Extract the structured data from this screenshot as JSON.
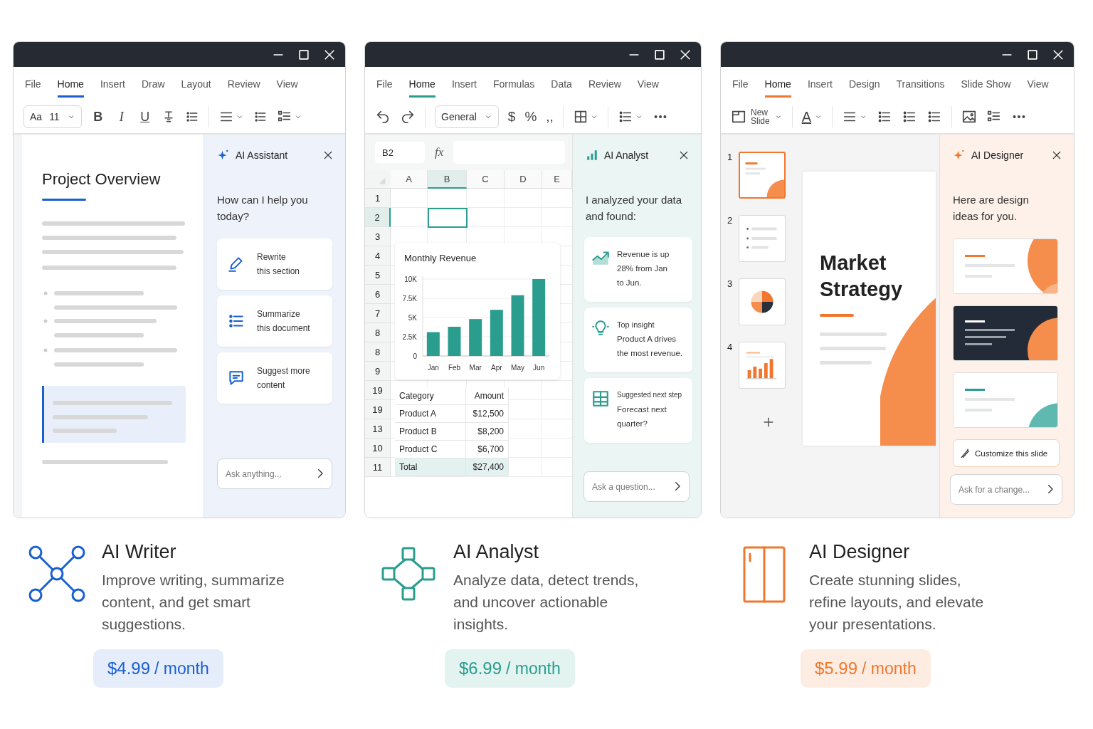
{
  "products": [
    {
      "kind": "writer",
      "menu": [
        {
          "label": "File",
          "selected": false
        },
        {
          "label": "Home",
          "selected": true
        },
        {
          "label": "Insert",
          "selected": false
        },
        {
          "label": "Draw",
          "selected": false
        },
        {
          "label": "Layout",
          "selected": false
        },
        {
          "label": "Review",
          "selected": false
        },
        {
          "label": "View",
          "selected": false
        }
      ],
      "toolbar": {
        "font": "Aa",
        "size": "11",
        "styles": [
          {
            "kind": "bold",
            "label": "B"
          },
          {
            "kind": "italic",
            "label": "I"
          },
          {
            "kind": "underline",
            "label": "U"
          }
        ]
      },
      "document": {
        "title": "Project Overview"
      },
      "panel": {
        "title": "AI Assistant",
        "message": "How can I help you\ntoday?",
        "actions": [
          {
            "kind": "rewrite",
            "label": "Rewrite\nthis section"
          },
          {
            "kind": "summarize",
            "label": "Summarize\nthis document"
          },
          {
            "kind": "suggest",
            "label": "Suggest more\ncontent"
          }
        ],
        "placeholder": "Ask anything..."
      },
      "title": "AI Writer",
      "description": "Improve writing, summarize\ncontent, and get smart\nsuggestions.",
      "price": "$4.99",
      "period": "/ month"
    },
    {
      "kind": "analyst",
      "menu": [
        {
          "label": "File",
          "selected": false
        },
        {
          "label": "Home",
          "selected": true
        },
        {
          "label": "Insert",
          "selected": false
        },
        {
          "label": "Formulas",
          "selected": false
        },
        {
          "label": "Data",
          "selected": false
        },
        {
          "label": "Review",
          "selected": false
        },
        {
          "label": "View",
          "selected": false
        }
      ],
      "toolbar": {
        "format": "General",
        "symbols": [
          "$",
          "%",
          ",,"
        ]
      },
      "sheet": {
        "name_box": "B2",
        "function_label": "fx",
        "columns": [
          {
            "label": "A",
            "selected": false
          },
          {
            "label": "B",
            "selected": true
          },
          {
            "label": "C",
            "selected": false
          },
          {
            "label": "D",
            "selected": false
          },
          {
            "label": "E",
            "selected": false
          }
        ],
        "rows": [
          {
            "label": "1",
            "selected": false
          },
          {
            "label": "2",
            "selected": true
          },
          {
            "label": "3",
            "selected": false
          },
          {
            "label": "4",
            "selected": false
          },
          {
            "label": "5",
            "selected": false
          },
          {
            "label": "6",
            "selected": false
          },
          {
            "label": "7",
            "selected": false
          },
          {
            "label": "8",
            "selected": false
          },
          {
            "label": "8",
            "selected": false
          },
          {
            "label": "9",
            "selected": false
          },
          {
            "label": "19",
            "selected": false
          },
          {
            "label": "19",
            "selected": false
          },
          {
            "label": "13",
            "selected": false
          },
          {
            "label": "10",
            "selected": false
          },
          {
            "label": "11",
            "selected": false
          }
        ],
        "chart": {
          "title": "Monthly Revenue",
          "chart_data": {
            "type": "bar",
            "grid": true,
            "categories": [
              "Jan",
              "Feb",
              "Mar",
              "Apr",
              "May",
              "Jun"
            ],
            "values": [
              3100,
              3800,
              4800,
              6000,
              7900,
              10000
            ],
            "ylim": [
              0,
              10000
            ],
            "yticks": [
              {
                "value": 0,
                "label": "0"
              },
              {
                "value": 2500,
                "label": "2.5K"
              },
              {
                "value": 5000,
                "label": "5K"
              },
              {
                "value": 7500,
                "label": "7.5K"
              },
              {
                "value": 10000,
                "label": "10K"
              }
            ]
          }
        },
        "table": {
          "columns": [
            "Category",
            "Amount"
          ],
          "rows": [
            {
              "kind": "item",
              "cells": [
                "Product A",
                "$12,500"
              ]
            },
            {
              "kind": "item",
              "cells": [
                "Product B",
                "$8,200"
              ]
            },
            {
              "kind": "item",
              "cells": [
                "Product C",
                "$6,700"
              ]
            },
            {
              "kind": "total",
              "cells": [
                "Total",
                "$27,400"
              ]
            }
          ]
        }
      },
      "panel": {
        "title": "AI Analyst",
        "message": "I analyzed your data\nand found:",
        "insights": [
          {
            "kind": "trend",
            "text": "Revenue is up\n28% from Jan\nto Jun."
          },
          {
            "kind": "insight",
            "label": "Top insight",
            "text": "Product A drives\nthe most revenue."
          },
          {
            "kind": "next-step",
            "label": "Suggested next step",
            "text": "Forecast next\nquarter?"
          }
        ],
        "placeholder": "Ask a question..."
      },
      "title": "AI Analyst",
      "description": "Analyze data, detect trends,\nand uncover actionable\ninsights.",
      "price": "$6.99",
      "period": "/ month"
    },
    {
      "kind": "designer",
      "menu": [
        {
          "label": "File",
          "selected": false
        },
        {
          "label": "Home",
          "selected": true
        },
        {
          "label": "Insert",
          "selected": false
        },
        {
          "label": "Design",
          "selected": false
        },
        {
          "label": "Transitions",
          "selected": false
        },
        {
          "label": "Slide Show",
          "selected": false
        },
        {
          "label": "View",
          "selected": false
        }
      ],
      "toolbar": {
        "new_slide": "New\nSlide",
        "font_color": "A"
      },
      "slides": [
        {
          "number": "1",
          "kind": "title",
          "selected": true
        },
        {
          "number": "2",
          "kind": "bullets",
          "selected": false
        },
        {
          "number": "3",
          "kind": "pie",
          "selected": false
        },
        {
          "number": "4",
          "kind": "bars",
          "selected": false
        }
      ],
      "slide": {
        "title": "Market\nStrategy"
      },
      "panel": {
        "title": "AI Designer",
        "message": "Here are design\nideas for you.",
        "designs": [
          {
            "kind": "light"
          },
          {
            "kind": "dark"
          },
          {
            "kind": "teal"
          }
        ],
        "customize": "Customize this slide",
        "placeholder": "Ask for a change..."
      },
      "title": "AI Designer",
      "description": "Create stunning slides,\nrefine layouts, and elevate\nyour presentations.",
      "price": "$5.99",
      "period": "/ month"
    }
  ]
}
